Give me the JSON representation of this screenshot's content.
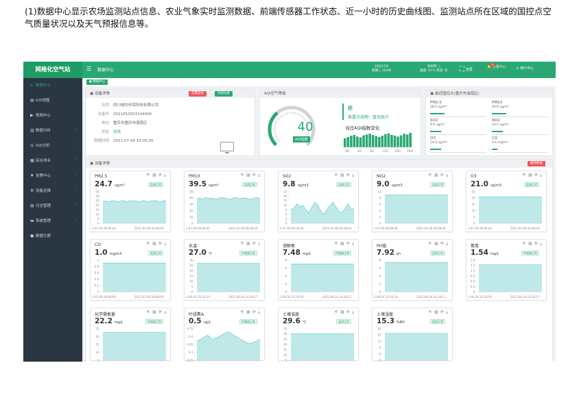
{
  "caption": "(1)数据中心显示农场监测站点信息、农业气象实时监测数据、前端传感器工作状态、近一小时的历史曲线图、监测站点所在区域的国控点空气质量状况以及天气预报信息等。",
  "topbar": {
    "logo": "网格化空气站",
    "menu_icon": "menu-icon",
    "crumb": "数据中心",
    "date_line1": "2021/7/6",
    "date_line2": "星期二 10:06",
    "weather_line1": "深圳市 ○",
    "weather_line2": "温度: 31℃ 风向: 东",
    "fullscreen_label": "全屏",
    "bell_label": "告警中心",
    "bell_count": "0",
    "user_label": "用户中心"
  },
  "sidebar": {
    "items": [
      {
        "label": "数据中心",
        "icon": "home-icon",
        "glyph": "⌂",
        "active": true,
        "arrow": ""
      },
      {
        "label": "GIS地图",
        "icon": "map-icon",
        "glyph": "▤",
        "active": false,
        "arrow": ""
      },
      {
        "label": "视频中心",
        "icon": "video-icon",
        "glyph": "▶",
        "active": false,
        "arrow": ""
      },
      {
        "label": "数据分析",
        "icon": "chart-icon",
        "glyph": "▥",
        "active": false,
        "arrow": "˅"
      },
      {
        "label": "AQI分析",
        "icon": "gauge-icon",
        "glyph": "◎",
        "active": false,
        "arrow": "˅"
      },
      {
        "label": "综合排名",
        "icon": "rank-icon",
        "glyph": "▦",
        "active": false,
        "arrow": "˅"
      },
      {
        "label": "告警中心",
        "icon": "bell-icon",
        "glyph": "♦",
        "active": false,
        "arrow": "˅"
      },
      {
        "label": "设备运维",
        "icon": "wrench-icon",
        "glyph": "⚙",
        "active": false,
        "arrow": "˅"
      },
      {
        "label": "日志管理",
        "icon": "log-icon",
        "glyph": "▤",
        "active": false,
        "arrow": "˅"
      },
      {
        "label": "系统管理",
        "icon": "settings-icon",
        "glyph": "▬",
        "active": false,
        "arrow": "˅"
      },
      {
        "label": "数据大屏",
        "icon": "screen-icon",
        "glyph": "●",
        "active": false,
        "arrow": ""
      }
    ]
  },
  "tagbar": {
    "active_tag": "● 数据中心"
  },
  "device_panel": {
    "title": "▣ 设备详情",
    "btn_history": "告警监控",
    "btn_add": "添加设备",
    "rows": [
      {
        "k": "名称",
        "v": "四川绿坊环保科技有限公司",
        "green": false
      },
      {
        "k": "设备号",
        "v": "2021052003104006",
        "green": false
      },
      {
        "k": "地址",
        "v": "重庆市重庆市潼南区",
        "green": false
      },
      {
        "k": "状态",
        "v": "在线",
        "green": true
      },
      {
        "k": "数据时间",
        "v": "2021-07-06 10:05:00",
        "green": false
      }
    ]
  },
  "aqi_panel": {
    "title": "AQI空气等级",
    "value": "40",
    "label": "AQI指数",
    "level": "优",
    "primary_pollutant": "首要污染物：暂无统计",
    "trend_title": "当日AQI指数变化",
    "trend_values": [
      22,
      25,
      28,
      30,
      26,
      24,
      29,
      31,
      33,
      30,
      27,
      25,
      28,
      32,
      34,
      30,
      28,
      26,
      29,
      33,
      31,
      35
    ],
    "trend_labels": [
      "0时",
      "4时",
      "8时",
      "12时",
      "16时",
      "20时"
    ],
    "fraction": 0.35
  },
  "pollutant_panel": {
    "title": "▣ 最近国控点(重庆市渝南区)",
    "items": [
      {
        "name": "PM2.5",
        "value": "28.0 ug/m³",
        "fraction": 0.25
      },
      {
        "name": "PM10",
        "value": "40.0 ug/m³",
        "fraction": 0.25
      },
      {
        "name": "SO2",
        "value": "9.0 ug/m³",
        "fraction": 0.2
      },
      {
        "name": "NO2",
        "value": "22.0 ug/m³",
        "fraction": 0.2
      },
      {
        "name": "O3",
        "value": "24.0 ug/m³",
        "fraction": 0.2
      },
      {
        "name": "CO",
        "value": "0.6 mg/m³",
        "fraction": 0.1
      }
    ]
  },
  "detail_section": {
    "title": "▣ 设备详情",
    "btn_label": "删除数据",
    "card_icons": "⚟ ▥ ⟳ ⤓"
  },
  "chart_data": [
    {
      "type": "area",
      "name": "PM2.5",
      "value": "24.7",
      "unit": "ug/m³",
      "status": "监测正常",
      "y_ticks": [
        "35",
        "30",
        "25",
        "20",
        "15",
        "10",
        "5",
        "0"
      ],
      "ylim": [
        0,
        35
      ],
      "x_labels": [
        "1-07-06 09:06:00",
        "2021-07-06 09:48:00"
      ],
      "values": [
        24,
        25,
        24,
        25,
        25,
        24,
        25,
        25,
        24,
        25,
        25,
        25,
        24,
        25,
        25,
        24,
        25,
        25,
        25,
        24,
        25,
        25
      ]
    },
    {
      "type": "area",
      "name": "PM10",
      "value": "39.5",
      "unit": "ug/m³",
      "status": "监测正常",
      "y_ticks": [
        "50",
        "40",
        "30",
        "20",
        "10",
        "0"
      ],
      "ylim": [
        0,
        50
      ],
      "x_labels": [
        "1-07-06 09:06:00",
        "2021-07-06 09:48:00"
      ],
      "values": [
        39,
        40,
        38,
        41,
        39,
        40,
        38,
        39,
        41,
        40,
        39,
        38,
        40,
        41,
        39,
        40,
        40,
        39,
        38,
        40,
        41,
        39
      ]
    },
    {
      "type": "area",
      "name": "SO2",
      "value": "9.8",
      "unit": "ug/m3",
      "status": "监测正常",
      "y_ticks": [
        "21",
        "18",
        "15",
        "12",
        "9",
        "6",
        "3",
        "0"
      ],
      "ylim": [
        0,
        21
      ],
      "x_labels": [
        "1-07-06 09:06:00",
        "2021-07-06 09:48:00"
      ],
      "values": [
        9,
        10,
        13,
        11,
        12,
        9,
        7,
        11,
        14,
        12,
        8,
        6,
        9,
        12,
        14,
        11,
        8,
        7,
        10,
        13,
        9,
        10
      ]
    },
    {
      "type": "area",
      "name": "NO2",
      "value": "9.0",
      "unit": "ug/m3",
      "status": "监测正常",
      "y_ticks": [
        "10",
        "8",
        "6",
        "4",
        "2",
        "0"
      ],
      "ylim": [
        0,
        10
      ],
      "x_labels": [
        "1-07-06 09:06:00",
        "2021-07-06 09:48:00"
      ],
      "values": [
        9,
        9,
        9,
        9,
        9,
        9,
        9,
        9,
        9,
        9,
        9,
        9,
        9,
        9,
        9,
        9,
        9,
        9,
        9,
        9,
        9,
        9
      ]
    },
    {
      "type": "area",
      "name": "O3",
      "value": "21.0",
      "unit": "ug/m3",
      "status": "监测正常",
      "y_ticks": [
        "25",
        "20",
        "15",
        "10",
        "5",
        "0"
      ],
      "ylim": [
        0,
        25
      ],
      "x_labels": [
        "1-07-06 09:06:00",
        "2021-07-06 09:48:00"
      ],
      "values": [
        21,
        21,
        21,
        21,
        21,
        21,
        21,
        21,
        21,
        21,
        21,
        21,
        21,
        21,
        21,
        21,
        21,
        21,
        21,
        21,
        21,
        21
      ]
    },
    {
      "type": "area",
      "name": "CO",
      "value": "1.0",
      "unit": "mg/m3",
      "status": "监测正常",
      "y_ticks": [
        "1",
        "0.8",
        "0.6",
        "0.4",
        "0.2",
        "0"
      ],
      "ylim": [
        0,
        1.1
      ],
      "x_labels": [
        "1-07-06 09:06:00",
        "2021-07-06 09:48:00"
      ],
      "values": [
        1,
        1,
        1,
        1,
        1,
        1,
        1,
        1,
        1,
        1,
        1,
        1,
        1,
        1,
        1,
        1,
        1,
        1,
        1,
        1,
        1,
        1
      ]
    },
    {
      "type": "area",
      "name": "水温",
      "value": "27.0",
      "unit": "℃",
      "status": "传感器正常",
      "y_ticks": [
        "30",
        "25",
        "20",
        "15",
        "10",
        "5",
        "0"
      ],
      "ylim": [
        0,
        30
      ],
      "x_labels": [
        "1-06-24 15:54:10",
        "2021-06-24 16:18:17"
      ],
      "values": [
        27,
        27,
        27,
        27,
        27,
        27,
        27,
        27,
        27,
        27,
        27,
        27,
        27,
        27,
        27,
        27,
        27,
        27,
        27,
        27,
        27,
        27
      ]
    },
    {
      "type": "area",
      "name": "溶解氧",
      "value": "7.48",
      "unit": "mg/L",
      "status": "传感器正常",
      "y_ticks": [
        "8",
        "6",
        "4",
        "2",
        "0"
      ],
      "ylim": [
        0,
        8.5
      ],
      "x_labels": [
        "1-06-24 15:54:10",
        "2021-06-24 16:18:17"
      ],
      "values": [
        7.5,
        7.5,
        7.5,
        7.5,
        7.5,
        7.5,
        7.5,
        7.5,
        7.5,
        7.5,
        7.5,
        7.5,
        7.5,
        7.5,
        7.5,
        7.5,
        7.5,
        7.5,
        7.5,
        7.5,
        7.5,
        7.5
      ]
    },
    {
      "type": "area",
      "name": "PH值",
      "value": "7.92",
      "unit": "ph",
      "status": "监测正常",
      "y_ticks": [
        "8",
        "6",
        "4",
        "2",
        "0"
      ],
      "ylim": [
        0,
        8.5
      ],
      "x_labels": [
        "1-06-24 15:54:10",
        "2021-06-24 16:18:17"
      ],
      "values": [
        7.9,
        7.9,
        7.9,
        7.9,
        7.9,
        7.9,
        7.9,
        7.9,
        7.9,
        7.9,
        7.9,
        7.9,
        7.9,
        7.9,
        7.9,
        7.9,
        7.9,
        7.9,
        7.9,
        7.9,
        7.9,
        7.9
      ]
    },
    {
      "type": "area",
      "name": "氨氮",
      "value": "1.54",
      "unit": "mg/L",
      "status": "传感器正常",
      "y_ticks": [
        "1.8",
        "1.5",
        "1.2",
        "0.9",
        "0.6",
        "0.3",
        "0"
      ],
      "ylim": [
        0,
        1.8
      ],
      "x_labels": [
        "1-06-24 15:54:10",
        "2021-06-24 16:18:17"
      ],
      "values": [
        1.54,
        1.54,
        1.54,
        1.54,
        1.54,
        1.54,
        1.54,
        1.54,
        1.54,
        1.54,
        1.54,
        1.54,
        1.54,
        1.54,
        1.54,
        1.54,
        1.54,
        1.54,
        1.54,
        1.54,
        1.54,
        1.54
      ]
    },
    {
      "type": "area",
      "name": "化学需氧量",
      "value": "22.2",
      "unit": "mg/L",
      "status": "传感器正常",
      "y_ticks": [
        "25",
        "20",
        "15",
        "10",
        "5"
      ],
      "ylim": [
        0,
        25
      ],
      "x_labels": [
        "",
        ""
      ],
      "values": [
        22,
        22,
        22,
        22,
        22,
        22,
        22,
        22,
        22,
        22,
        22,
        22,
        22,
        22,
        22,
        22,
        22,
        22,
        22,
        22,
        22,
        22
      ]
    },
    {
      "type": "area",
      "name": "叶绿素A",
      "value": "0.5",
      "unit": "ug/L",
      "status": "传感器正常",
      "y_ticks": [
        "0.75",
        "0.6",
        "0.45",
        "0.3",
        "0.15"
      ],
      "ylim": [
        0,
        0.75
      ],
      "x_labels": [
        "",
        ""
      ],
      "values": [
        0.45,
        0.52,
        0.6,
        0.5,
        0.55,
        0.62,
        0.68,
        0.6,
        0.52,
        0.45,
        0.4,
        0.44,
        0.5
      ]
    },
    {
      "type": "area",
      "name": "土壤温度",
      "value": "29.6",
      "unit": "℃",
      "status": "监测正常",
      "y_ticks": [
        "35",
        "30",
        "25",
        "20",
        "15",
        "10",
        "5"
      ],
      "ylim": [
        0,
        35
      ],
      "x_labels": [
        "",
        ""
      ],
      "values": [
        29.6,
        29.6,
        29.6,
        29.6,
        29.6,
        29.6,
        29.6,
        29.6,
        29.6,
        29.6,
        29.6,
        29.6,
        29.6,
        29.6,
        29.6,
        29.6,
        29.6,
        29.6,
        29.6,
        29.6,
        29.6,
        29.6
      ]
    },
    {
      "type": "area",
      "name": "土壤湿度",
      "value": "15.3",
      "unit": "%RH",
      "status": "监测正常",
      "y_ticks": [
        "18",
        "15",
        "12",
        "9",
        "6",
        "3"
      ],
      "ylim": [
        0,
        18
      ],
      "x_labels": [
        "",
        ""
      ],
      "values": [
        15.3,
        15.3,
        15.3,
        15.3,
        15.3,
        15.3,
        15.3,
        15.3,
        15.3,
        15.3,
        15.3,
        15.3,
        15.3,
        15.3,
        15.3,
        15.3,
        15.3,
        15.3,
        15.3,
        15.3,
        15.3,
        15.3
      ]
    }
  ],
  "colors": {
    "brand": "#2aa873",
    "sidebar": "#2b3643",
    "area_fill": "#bfe9e8",
    "area_line": "#6fd0cf",
    "danger": "#f0585f"
  }
}
